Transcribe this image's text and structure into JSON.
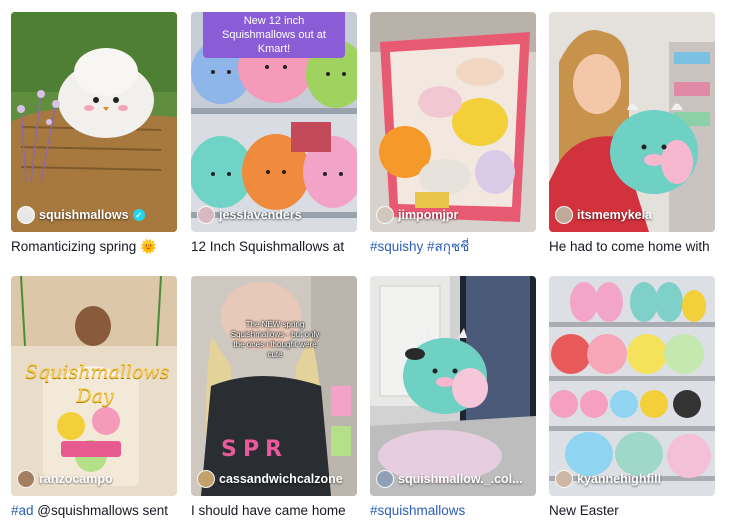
{
  "cards": [
    {
      "username": "squishmallows",
      "verified": true,
      "caption_text": "Romanticizing spring",
      "caption_emoji": "🌞",
      "avatar_color": "#e8e8e8"
    },
    {
      "username": "jesslavenders",
      "banner": "New 12 inch Squishmallows out at Kmart!",
      "caption_text": "12 Inch Squishmallows at",
      "avatar_color": "#d9b8c4"
    },
    {
      "username": "jimpomjpr",
      "caption_tags": "#squishy #สกุชชี่",
      "avatar_color": "#d0c7bd"
    },
    {
      "username": "itsmemykela",
      "caption_text": "He had to come home with",
      "avatar_color": "#bfa999"
    },
    {
      "username": "ranzocampo",
      "overlay_text": "Squishmallows Day",
      "caption_tag": "#ad",
      "caption_text": " @squishmallows sent",
      "avatar_color": "#a47e62"
    },
    {
      "username": "cassandwichcalzone",
      "overlay_text": "The NEW spring Squishmallows - but only the ones i thought were cute",
      "caption_text": "I should have came home",
      "avatar_color": "#c2a16b"
    },
    {
      "username": "squishmallow._.col...",
      "caption_tags": "#squishmallows",
      "avatar_color": "#8fa0b8"
    },
    {
      "username": "kyannehighfill",
      "caption_text": "New Easter",
      "avatar_color": "#cfb7a5"
    }
  ],
  "colors": {
    "hashtag": "#2b5db9",
    "caption": "#161823",
    "banner": "#8a5cd6"
  }
}
